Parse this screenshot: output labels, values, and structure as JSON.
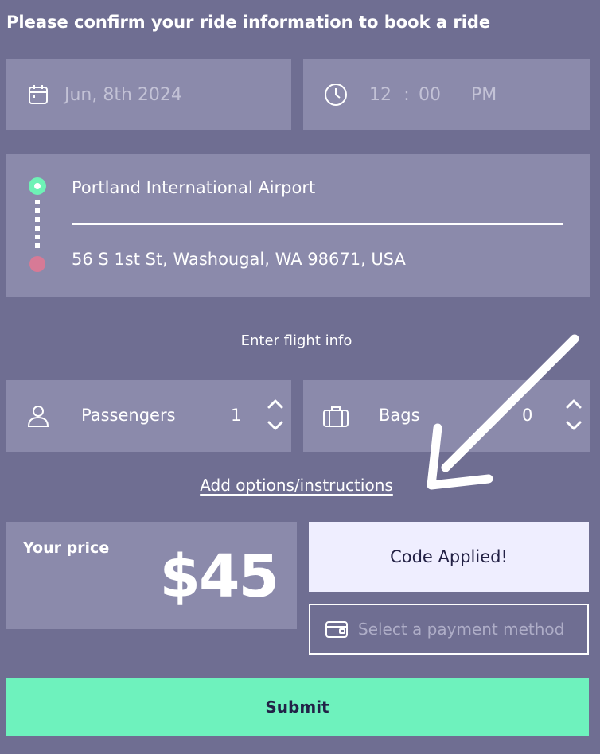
{
  "header": {
    "title": "Please confirm your ride information to book a ride"
  },
  "datetime": {
    "date": "Jun, 8th 2024",
    "hour": "12",
    "separator": ":",
    "minute": "00",
    "ampm": "PM"
  },
  "route": {
    "origin": "Portland International Airport",
    "destination": "56 S 1st St, Washougal, WA 98671, USA"
  },
  "flight": {
    "label": "Enter flight info"
  },
  "passengers": {
    "label": "Passengers",
    "value": "1"
  },
  "bags": {
    "label": "Bags",
    "value": "0"
  },
  "options": {
    "link": "Add options/instructions"
  },
  "price": {
    "label": "Your price",
    "value": "$45"
  },
  "promo": {
    "status": "Code Applied!"
  },
  "payment": {
    "placeholder": "Select a payment method"
  },
  "submit": {
    "label": "Submit"
  },
  "colors": {
    "background": "#6f6e92",
    "panel": "#8b8aab",
    "accent_green": "#6ef2bd",
    "destination_red": "#d77a96"
  },
  "icons": [
    "calendar-icon",
    "clock-icon",
    "user-icon",
    "luggage-icon",
    "chevron-up-icon",
    "chevron-down-icon",
    "wallet-icon",
    "arrow-annotation"
  ]
}
